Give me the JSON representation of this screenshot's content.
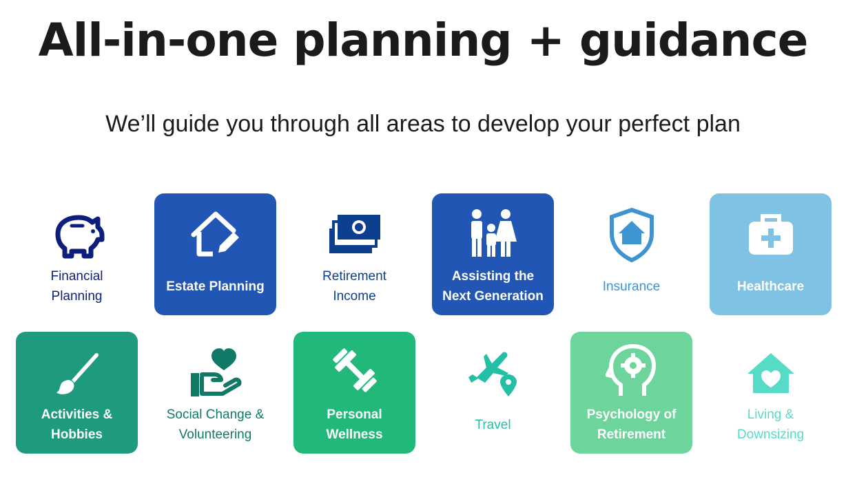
{
  "headline": "All-in-one planning + guidance",
  "subheadline": "We’ll guide you through all areas to develop your perfect plan",
  "tiles": [
    {
      "label": "Financial\nPlanning",
      "icon": "piggy-bank-icon",
      "bg": "transparent",
      "color": "#0d1f7a"
    },
    {
      "label": "Estate Planning",
      "icon": "house-pencil-icon",
      "bg": "#2156b4",
      "color": "#ffffff"
    },
    {
      "label": "Retirement\nIncome",
      "icon": "cash-stack-icon",
      "bg": "transparent",
      "color": "#0d3f8f"
    },
    {
      "label": "Assisting the\nNext Generation",
      "icon": "family-icon",
      "bg": "#2156b4",
      "color": "#ffffff"
    },
    {
      "label": "Insurance",
      "icon": "shield-house-icon",
      "bg": "transparent",
      "color": "#3e93d1"
    },
    {
      "label": "Healthcare",
      "icon": "medical-bag-icon",
      "bg": "#7fc2e3",
      "color": "#ffffff"
    },
    {
      "label": "Activities &\nHobbies",
      "icon": "paintbrush-icon",
      "bg": "#1e9b7e",
      "color": "#ffffff"
    },
    {
      "label": "Social Change &\nVolunteering",
      "icon": "heart-hand-icon",
      "bg": "transparent",
      "color": "#117a66"
    },
    {
      "label": "Personal\nWellness",
      "icon": "dumbbell-icon",
      "bg": "#20b97a",
      "color": "#ffffff"
    },
    {
      "label": "Travel",
      "icon": "plane-pin-icon",
      "bg": "transparent",
      "color": "#25bfa6"
    },
    {
      "label": "Psychology of\nRetirement",
      "icon": "head-gear-icon",
      "bg": "#6dd49c",
      "color": "#ffffff"
    },
    {
      "label": "Living &\nDownsizing",
      "icon": "house-heart-icon",
      "bg": "transparent",
      "color": "#56dbc6"
    }
  ]
}
